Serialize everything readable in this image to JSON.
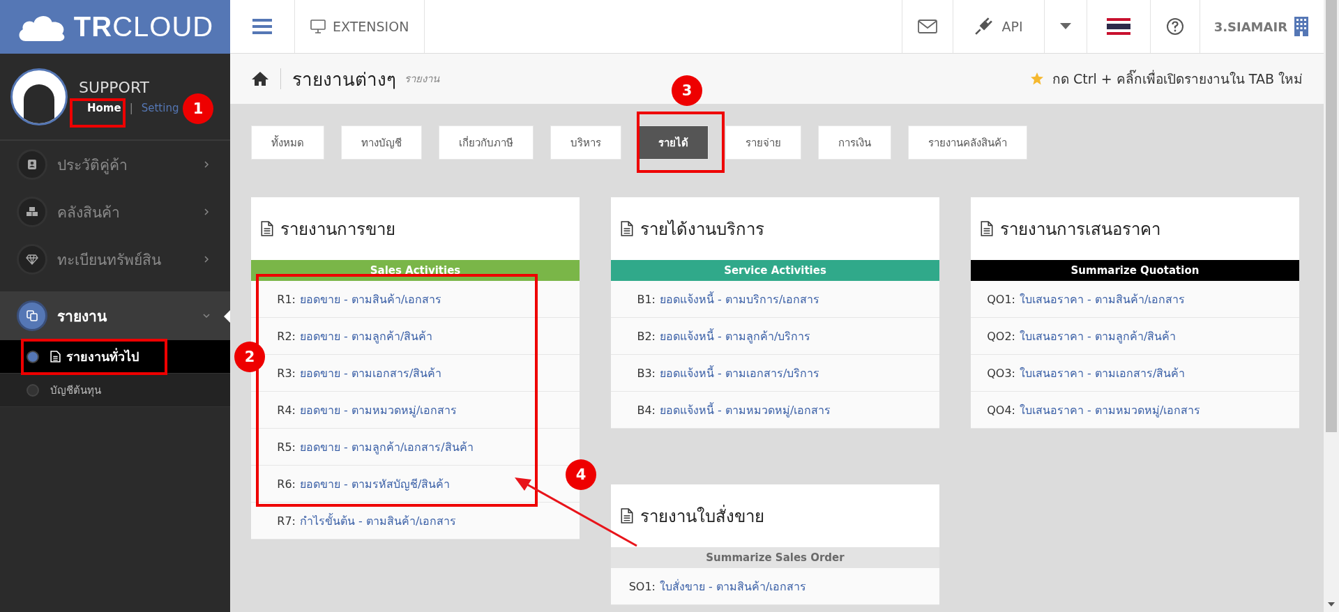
{
  "logo": {
    "text": "**TR**CLOUD"
  },
  "user": {
    "name": "SUPPORT",
    "home": "Home",
    "separator": "|",
    "setting": "Setting"
  },
  "sidebar": {
    "items": [
      {
        "label": "ประวัติคู่ค้า",
        "expanded": false,
        "selected": false
      },
      {
        "label": "คลังสินค้า",
        "expanded": false,
        "selected": false
      },
      {
        "label": "ทะเบียนทรัพย์สิน",
        "expanded": false,
        "selected": false
      },
      {
        "label": "รายงาน",
        "expanded": true,
        "selected": true,
        "children": [
          {
            "label": "รายงานทั่วไป",
            "selected": true
          },
          {
            "label": "บัญชีต้นทุน",
            "selected": false
          }
        ]
      }
    ]
  },
  "topbar": {
    "extension": "EXTENSION",
    "api": "API",
    "company": "3.SIAMAIR"
  },
  "breadcrumb": {
    "title": "รายงานต่างๆ",
    "subtitle": "รายงาน",
    "hint": "กด Ctrl + คลิ๊กเพื่อเปิดรายงานใน TAB ใหม่"
  },
  "tabs": [
    {
      "label": "ทั้งหมด",
      "selected": false
    },
    {
      "label": "ทางบัญชี",
      "selected": false
    },
    {
      "label": "เกี่ยวกับภาษี",
      "selected": false
    },
    {
      "label": "บริหาร",
      "selected": false
    },
    {
      "label": "รายได้",
      "selected": true
    },
    {
      "label": "รายจ่าย",
      "selected": false
    },
    {
      "label": "การเงิน",
      "selected": false
    },
    {
      "label": "รายงานคลังสินค้า",
      "selected": false
    }
  ],
  "columns": [
    {
      "cards": [
        {
          "title": "รายงานการขาย",
          "band": "Sales Activities",
          "color": "#7ab648",
          "rows": [
            {
              "code": "R1:",
              "label": "ยอดขาย - ตามสินค้า/เอกสาร"
            },
            {
              "code": "R2:",
              "label": "ยอดขาย - ตามลูกค้า/สินค้า"
            },
            {
              "code": "R3:",
              "label": "ยอดขาย - ตามเอกสาร/สินค้า"
            },
            {
              "code": "R4:",
              "label": "ยอดขาย - ตามหมวดหมู่/เอกสาร"
            },
            {
              "code": "R5:",
              "label": "ยอดขาย - ตามลูกค้า/เอกสาร/สินค้า"
            },
            {
              "code": "R6:",
              "label": "ยอดขาย - ตามรหัสบัญชี/สินค้า"
            },
            {
              "code": "R7:",
              "label": "กำไรขั้นต้น - ตามสินค้า/เอกสาร"
            }
          ]
        }
      ]
    },
    {
      "cards": [
        {
          "title": "รายได้งานบริการ",
          "band": "Service Activities",
          "color": "#30a98a",
          "rows": [
            {
              "code": "B1:",
              "label": "ยอดแจ้งหนี้ - ตามบริการ/เอกสาร"
            },
            {
              "code": "B2:",
              "label": "ยอดแจ้งหนี้ - ตามลูกค้า/บริการ"
            },
            {
              "code": "B3:",
              "label": "ยอดแจ้งหนี้ - ตามเอกสาร/บริการ"
            },
            {
              "code": "B4:",
              "label": "ยอดแจ้งหนี้ - ตามหมวดหมู่/เอกสาร"
            }
          ]
        },
        {
          "title": "รายงานใบสั่งขาย",
          "band": "Summarize Sales Order",
          "color": "#e3e3e3",
          "rows": [
            {
              "code": "SO1:",
              "label": "ใบสั่งขาย - ตามสินค้า/เอกสาร"
            }
          ]
        }
      ]
    },
    {
      "cards": [
        {
          "title": "รายงานการเสนอราคา",
          "band": "Summarize Quotation",
          "color": "#000000",
          "rows": [
            {
              "code": "QO1:",
              "label": "ใบเสนอราคา - ตามสินค้า/เอกสาร"
            },
            {
              "code": "QO2:",
              "label": "ใบเสนอราคา - ตามลูกค้า/สินค้า"
            },
            {
              "code": "QO3:",
              "label": "ใบเสนอราคา - ตามเอกสาร/สินค้า"
            },
            {
              "code": "QO4:",
              "label": "ใบเสนอราคา - ตามหมวดหมู่/เอกสาร"
            }
          ]
        }
      ]
    }
  ],
  "annotations": [
    {
      "number": "1"
    },
    {
      "number": "2"
    },
    {
      "number": "3"
    },
    {
      "number": "4"
    }
  ]
}
